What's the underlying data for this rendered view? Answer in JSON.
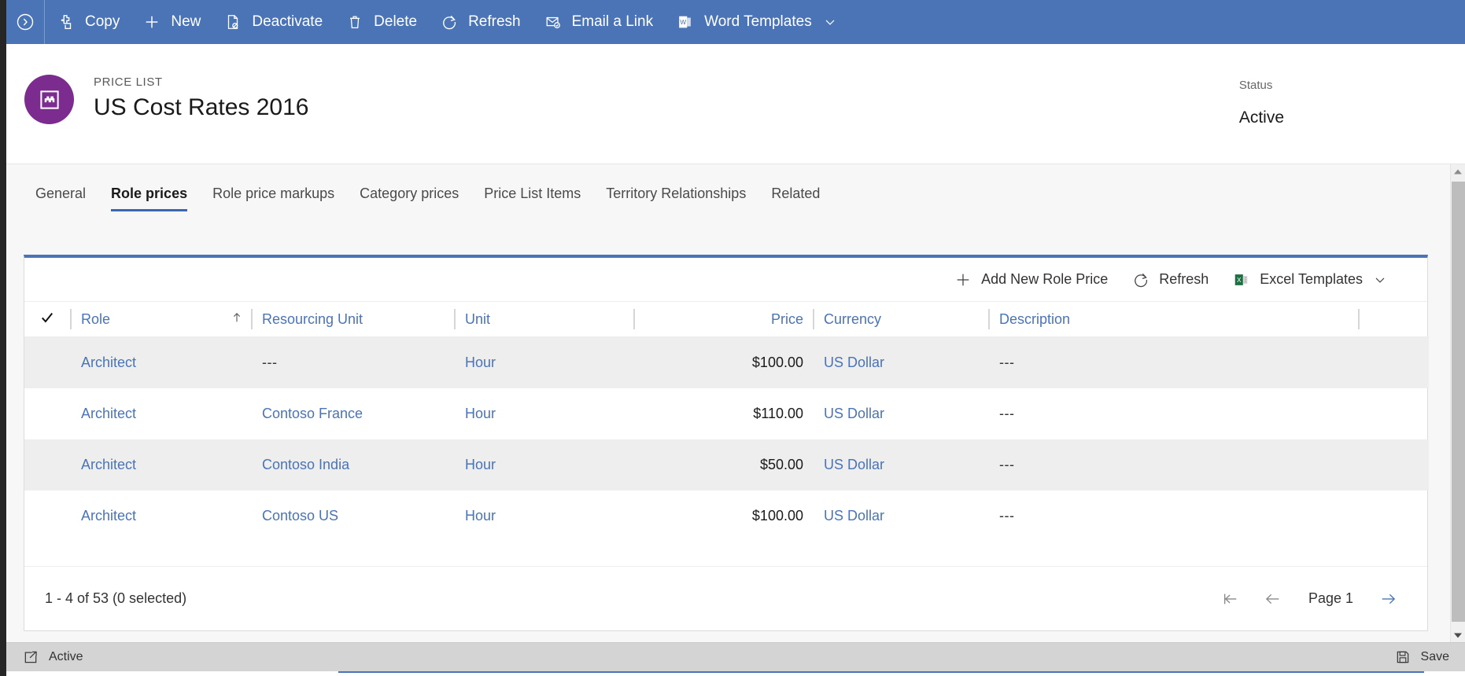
{
  "colors": {
    "command_bar": "#4a74b5",
    "accent": "#4a74b5",
    "entity_avatar": "#7c2c8f",
    "row_alt": "#eeeeee",
    "link": "#4a74b5"
  },
  "command_bar": {
    "expand_icon": "chevron-right-circle-icon",
    "buttons": [
      {
        "label": "Copy",
        "icon": "copy-icon"
      },
      {
        "label": "New",
        "icon": "plus-icon"
      },
      {
        "label": "Deactivate",
        "icon": "deactivate-page-icon"
      },
      {
        "label": "Delete",
        "icon": "trash-icon"
      },
      {
        "label": "Refresh",
        "icon": "refresh-icon"
      },
      {
        "label": "Email a Link",
        "icon": "email-link-icon"
      },
      {
        "label": "Word Templates",
        "icon": "word-icon",
        "has_chevron": true
      }
    ]
  },
  "record_header": {
    "entity_label": "PRICE LIST",
    "record_name": "US Cost Rates 2016",
    "avatar_icon": "price-list-icon",
    "status_field": {
      "label": "Status",
      "value": "Active"
    }
  },
  "tabs": [
    {
      "label": "General",
      "active": false
    },
    {
      "label": "Role prices",
      "active": true
    },
    {
      "label": "Role price markups",
      "active": false
    },
    {
      "label": "Category prices",
      "active": false
    },
    {
      "label": "Price List Items",
      "active": false
    },
    {
      "label": "Territory Relationships",
      "active": false
    },
    {
      "label": "Related",
      "active": false
    }
  ],
  "grid_toolbar": [
    {
      "label": "Add New Role Price",
      "icon": "plus-icon"
    },
    {
      "label": "Refresh",
      "icon": "refresh-icon"
    },
    {
      "label": "Excel Templates",
      "icon": "excel-icon",
      "has_chevron": true
    }
  ],
  "grid": {
    "select_all_icon": "checkmark-icon",
    "sort_column": "Role",
    "sort_direction": "ascending",
    "sort_icon": "arrow-up-icon",
    "columns": [
      {
        "key": "role",
        "label": "Role",
        "align": "left"
      },
      {
        "key": "resourcing_unit",
        "label": "Resourcing Unit",
        "align": "left"
      },
      {
        "key": "unit",
        "label": "Unit",
        "align": "left"
      },
      {
        "key": "price",
        "label": "Price",
        "align": "right"
      },
      {
        "key": "currency",
        "label": "Currency",
        "align": "left"
      },
      {
        "key": "description",
        "label": "Description",
        "align": "left"
      }
    ],
    "rows": [
      {
        "role": "Architect",
        "resourcing_unit": "---",
        "unit": "Hour",
        "price": "$100.00",
        "currency": "US Dollar",
        "description": "---"
      },
      {
        "role": "Architect",
        "resourcing_unit": "Contoso France",
        "unit": "Hour",
        "price": "$110.00",
        "currency": "US Dollar",
        "description": "---"
      },
      {
        "role": "Architect",
        "resourcing_unit": "Contoso India",
        "unit": "Hour",
        "price": "$50.00",
        "currency": "US Dollar",
        "description": "---"
      },
      {
        "role": "Architect",
        "resourcing_unit": "Contoso US",
        "unit": "Hour",
        "price": "$100.00",
        "currency": "US Dollar",
        "description": "---"
      }
    ],
    "footer": {
      "record_count": "1 - 4 of 53 (0 selected)",
      "page_label": "Page 1",
      "first_page_icon": "first-page-icon",
      "previous_page_icon": "previous-page-icon",
      "next_page_icon": "next-page-icon"
    }
  },
  "status_bar": {
    "left": {
      "label": "Active",
      "icon": "popout-icon"
    },
    "right": {
      "label": "Save",
      "icon": "save-floppy-icon"
    }
  }
}
